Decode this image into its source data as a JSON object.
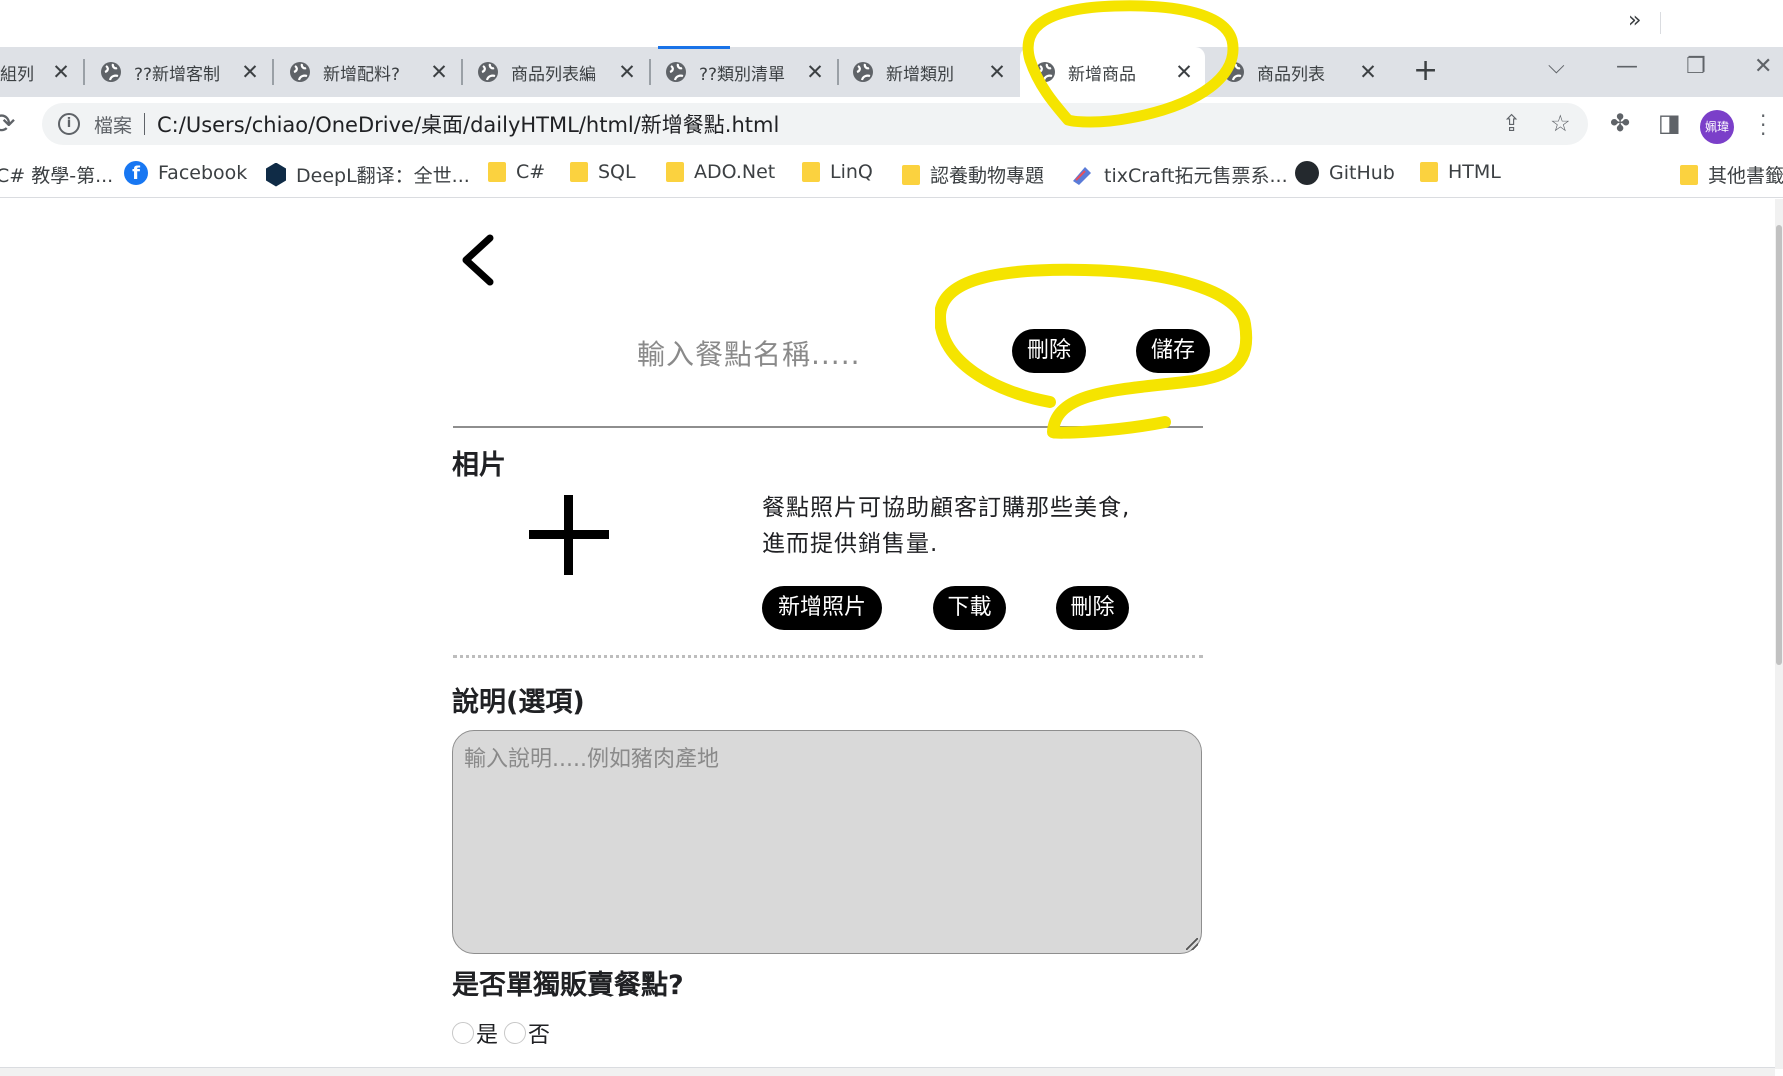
{
  "browser": {
    "tabs": [
      {
        "label": "組列",
        "active": false
      },
      {
        "label": "??新增客制",
        "active": false
      },
      {
        "label": "新增配料?",
        "active": false
      },
      {
        "label": "商品列表編",
        "active": false
      },
      {
        "label": "??類別清單",
        "active": false
      },
      {
        "label": "新增類別",
        "active": false
      },
      {
        "label": "新增商品",
        "active": true
      },
      {
        "label": "商品列表",
        "active": false
      }
    ],
    "new_tab_icon": "plus-icon",
    "address": {
      "label": "檔案",
      "url": "C:/Users/chiao/OneDrive/桌面/dailyHTML/html/新增餐點.html"
    },
    "avatar_text": "姵瑋",
    "bookmarks": [
      {
        "label": "C# 教學-第...",
        "icon": "none"
      },
      {
        "label": "Facebook",
        "icon": "facebook-icon"
      },
      {
        "label": "DeepL翻译：全世...",
        "icon": "deepl-icon"
      },
      {
        "label": "C#",
        "icon": "folder-icon"
      },
      {
        "label": "SQL",
        "icon": "folder-icon"
      },
      {
        "label": "ADO.Net",
        "icon": "folder-icon"
      },
      {
        "label": "LinQ",
        "icon": "folder-icon"
      },
      {
        "label": "認養動物專題",
        "icon": "folder-icon"
      },
      {
        "label": "tixCraft拓元售票系...",
        "icon": "tixcraft-icon"
      },
      {
        "label": "GitHub",
        "icon": "github-icon"
      },
      {
        "label": "HTML",
        "icon": "folder-icon"
      }
    ],
    "bookmarks_more": "»",
    "other_bookmarks": "其他書籤"
  },
  "form": {
    "name_placeholder": "輸入餐點名稱.....",
    "delete_label": "刪除",
    "save_label": "儲存",
    "photo_section_title": "相片",
    "photo_desc_line1": "餐點照片可協助顧客訂購那些美食,",
    "photo_desc_line2": "進而提供銷售量.",
    "add_photo_label": "新增照片",
    "download_label": "下載",
    "photo_delete_label": "刪除",
    "description_title": "說明(選項)",
    "description_placeholder": "輸入說明.....例如豬肉產地",
    "sold_separately_title": "是否單獨販賣餐點?",
    "option_yes": "是",
    "option_no": "否"
  },
  "colors": {
    "annotation_highlight": "#f5e400",
    "button_bg": "#000000",
    "textarea_bg": "#d9d9d9"
  }
}
